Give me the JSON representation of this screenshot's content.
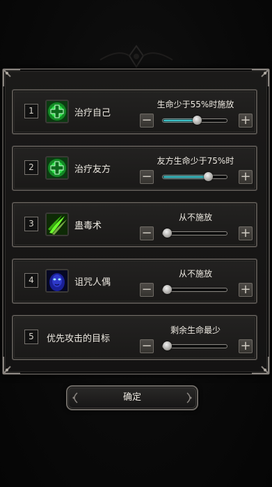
{
  "confirm_label": "确定",
  "colors": {
    "slider_fill": "#3fc6cc",
    "frame": "#56524e",
    "heal_icon": "#2ee04a",
    "poison_icon": "#6bff2a",
    "curse_icon": "#2e39c9"
  },
  "rows": [
    {
      "num": "1",
      "icon": "heal-cross-icon",
      "name": "治疗自己",
      "condition": "生命少于55%时施放",
      "slider_value": 0.55,
      "minus": "−",
      "plus": "+"
    },
    {
      "num": "2",
      "icon": "heal-cross-icon",
      "name": "治疗友方",
      "condition": "友方生命少于75%时",
      "slider_value": 0.75,
      "minus": "−",
      "plus": "+"
    },
    {
      "num": "3",
      "icon": "poison-claw-icon",
      "name": "蛊毒术",
      "condition": "从不施放",
      "slider_value": 0,
      "minus": "−",
      "plus": "+"
    },
    {
      "num": "4",
      "icon": "curse-doll-icon",
      "name": "诅咒人偶",
      "condition": "从不施放",
      "slider_value": 0,
      "minus": "−",
      "plus": "+"
    },
    {
      "num": "5",
      "icon": "",
      "name": "优先攻击的目标",
      "condition": "剩余生命最少",
      "slider_value": 0,
      "minus": "−",
      "plus": "+"
    }
  ]
}
